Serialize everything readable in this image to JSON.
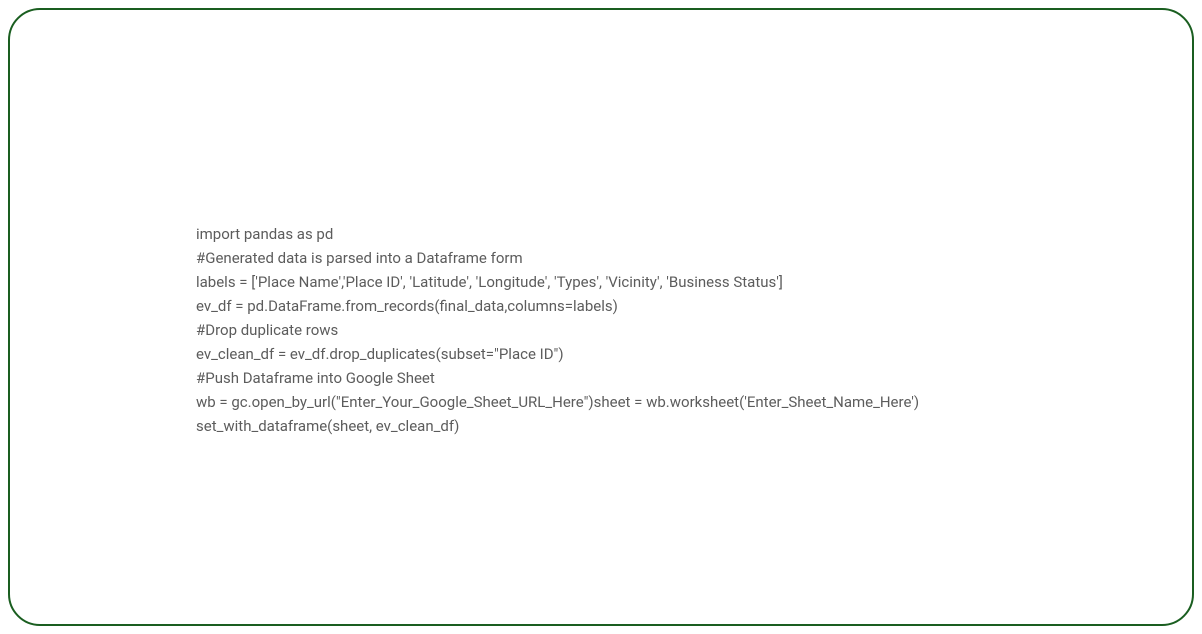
{
  "code": {
    "lines": [
      "import pandas as pd",
      "#Generated data is parsed into a Dataframe form",
      "labels = ['Place Name','Place ID', 'Latitude', 'Longitude', 'Types', 'Vicinity', 'Business Status']",
      "ev_df = pd.DataFrame.from_records(final_data,columns=labels)",
      "#Drop duplicate rows",
      "ev_clean_df = ev_df.drop_duplicates(subset=\"Place ID\")",
      "#Push Dataframe into Google Sheet",
      "wb = gc.open_by_url(\"Enter_Your_Google_Sheet_URL_Here\")sheet = wb.worksheet('Enter_Sheet_Name_Here')",
      "set_with_dataframe(sheet, ev_clean_df)"
    ]
  }
}
